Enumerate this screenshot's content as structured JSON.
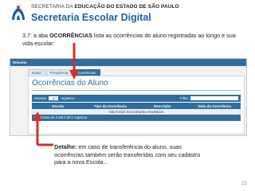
{
  "header": {
    "line1_prefix": "SECRETARIA DA ",
    "line1_bold": "EDUCAÇÃO DO ESTADO DE SÃO PAULO",
    "line2": "Secretaria Escolar Digital"
  },
  "intro": {
    "prefix": "3.7: a aba ",
    "bold": "OCORRÊNCIAS",
    "rest": " lista as ocorrências do aluno registradas ao longo e sua vida escolar:"
  },
  "app": {
    "topbar": "Resumo",
    "tabs": [
      "Notas",
      "Frequência",
      "Ocorrências"
    ],
    "panel_title": "Ocorrências do Aluno",
    "controls": {
      "show_label": "Mostrar",
      "page_size": "10",
      "records_label": "registros",
      "search_label": "Filtro"
    },
    "columns": [
      "Escola",
      "Tipo da Ocorrência",
      "Descrição",
      "Data da Ocorrência"
    ],
    "empty_message": "Não foram encontrados resultados",
    "footer_info": "Mostrando de 0 até 0 de 0 registros"
  },
  "detail": {
    "bold": "Detalhe:",
    "rest": " em caso de transferência do aluno, suas ocorrências também serão transferidas com seu cadastro para a nova Escola..."
  },
  "page_number": "21",
  "colors": {
    "brand_blue": "#1a5fa8",
    "app_blue": "#2e6d9f",
    "arrow_red": "#d1302b"
  }
}
